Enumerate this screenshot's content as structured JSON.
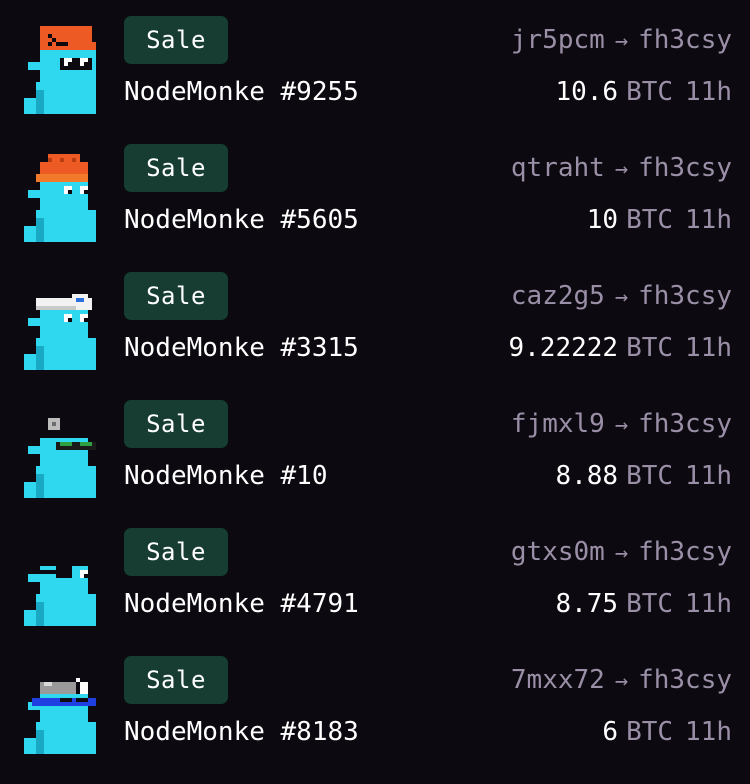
{
  "colors": {
    "background": "#0c0a10",
    "badge_background": "#173d33",
    "muted_text": "#9b8fa7",
    "primary_text": "#ffffff",
    "monke_cyan": "#2fd8ef"
  },
  "activity": [
    {
      "type": "Sale",
      "name": "NodeMonke #9255",
      "from": "jr5pcm",
      "arrow": "→",
      "to": "fh3csy",
      "price": "10.6",
      "unit": "BTC",
      "time": "11h",
      "accessory": "orange-cap-with-terminal-icon"
    },
    {
      "type": "Sale",
      "name": "NodeMonke #5605",
      "from": "qtraht",
      "arrow": "→",
      "to": "fh3csy",
      "price": "10",
      "unit": "BTC",
      "time": "11h",
      "accessory": "orange-beanie"
    },
    {
      "type": "Sale",
      "name": "NodeMonke #3315",
      "from": "caz2g5",
      "arrow": "→",
      "to": "fh3csy",
      "price": "9.22222",
      "unit": "BTC",
      "time": "11h",
      "accessory": "white-cap"
    },
    {
      "type": "Sale",
      "name": "NodeMonke #10",
      "from": "fjmxl9",
      "arrow": "→",
      "to": "fh3csy",
      "price": "8.88",
      "unit": "BTC",
      "time": "11h",
      "accessory": "green-glasses"
    },
    {
      "type": "Sale",
      "name": "NodeMonke #4791",
      "from": "gtxs0m",
      "arrow": "→",
      "to": "fh3csy",
      "price": "8.75",
      "unit": "BTC",
      "time": "11h",
      "accessory": "eye-patch"
    },
    {
      "type": "Sale",
      "name": "NodeMonke #8183",
      "from": "7mxx72",
      "arrow": "→",
      "to": "fh3csy",
      "price": "6",
      "unit": "BTC",
      "time": "11h",
      "accessory": "blue-goggles"
    }
  ]
}
